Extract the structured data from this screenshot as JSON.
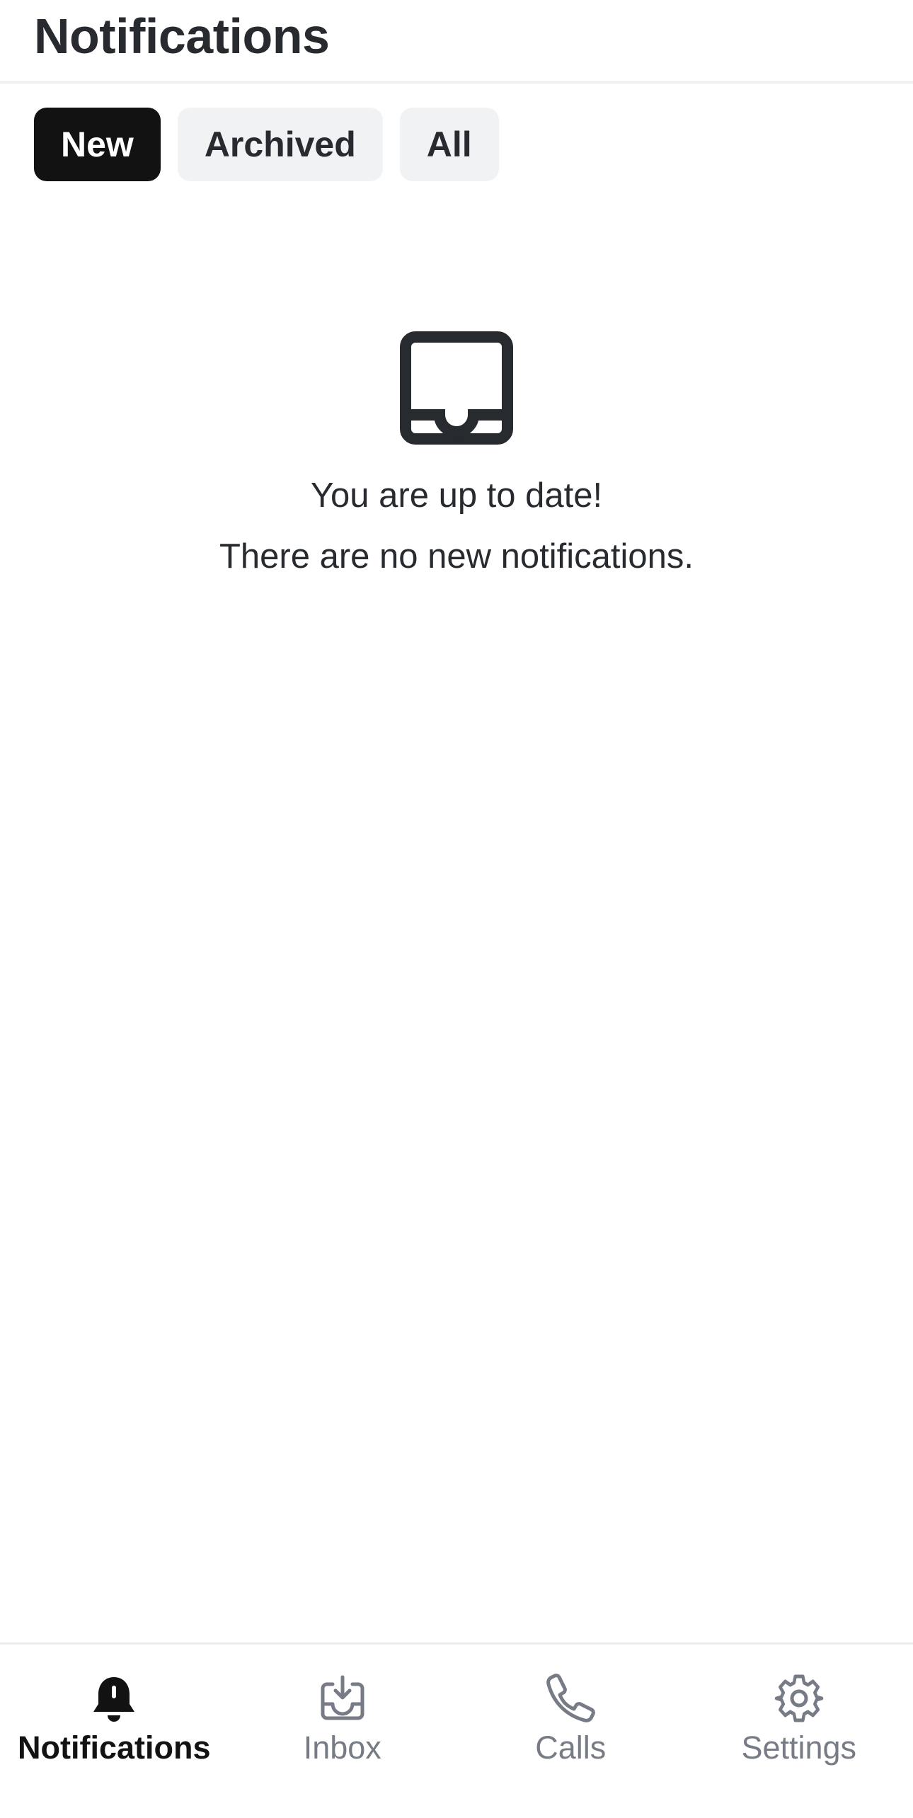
{
  "header": {
    "title": "Notifications"
  },
  "tabs": [
    {
      "label": "New",
      "active": true
    },
    {
      "label": "Archived",
      "active": false
    },
    {
      "label": "All",
      "active": false
    }
  ],
  "empty_state": {
    "icon": "inbox-tray-icon",
    "line1": "You are up to date!",
    "line2": "There are no new notifications."
  },
  "bottom_nav": {
    "items": [
      {
        "label": "Notifications",
        "icon": "bell-icon",
        "active": true
      },
      {
        "label": "Inbox",
        "icon": "inbox-download-icon",
        "active": false
      },
      {
        "label": "Calls",
        "icon": "phone-icon",
        "active": false
      },
      {
        "label": "Settings",
        "icon": "gear-icon",
        "active": false
      }
    ]
  },
  "colors": {
    "text": "#272a2e",
    "active_tab_bg": "#121212",
    "tab_bg": "#f1f2f4",
    "inactive_nav": "#767b85",
    "divider": "#ececee"
  }
}
